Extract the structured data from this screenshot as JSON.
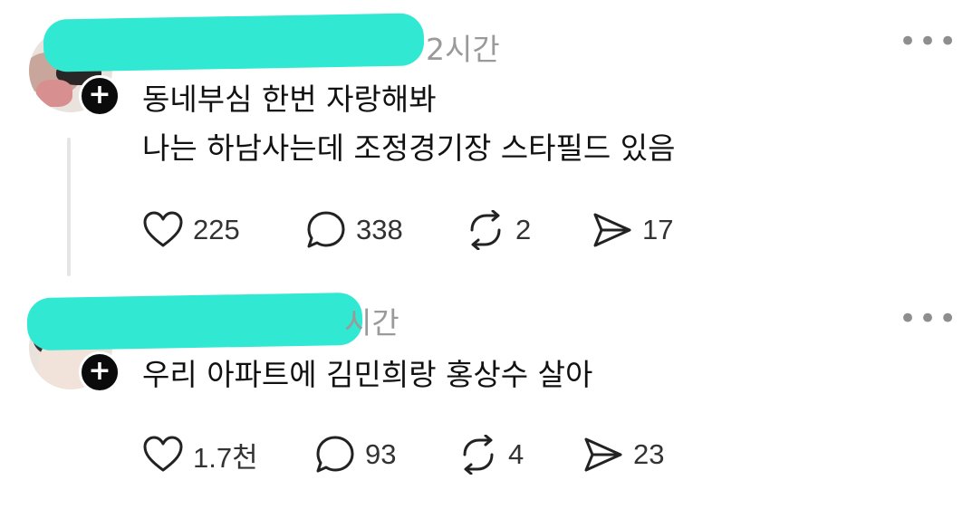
{
  "posts": [
    {
      "time": "2시간",
      "lines": [
        "동네부심 한번 자랑해봐",
        "나는 하남사는데 조정경기장 스타필드 있음"
      ],
      "likes": "225",
      "replies": "338",
      "reposts": "2",
      "shares": "17"
    },
    {
      "time": "시간",
      "lines": [
        "우리 아파트에 김민희랑 홍상수 살아"
      ],
      "likes": "1.7천",
      "replies": "93",
      "reposts": "4",
      "shares": "23"
    }
  ],
  "icons": {
    "more": "more-icon",
    "follow": "plus-icon",
    "like": "heart-icon",
    "reply": "comment-icon",
    "repost": "repost-icon",
    "share": "send-icon"
  },
  "colors": {
    "redaction": "#31e8d3",
    "muted": "#9a9a9a"
  },
  "glyphs": {
    "more": "•••",
    "plus": "+"
  }
}
